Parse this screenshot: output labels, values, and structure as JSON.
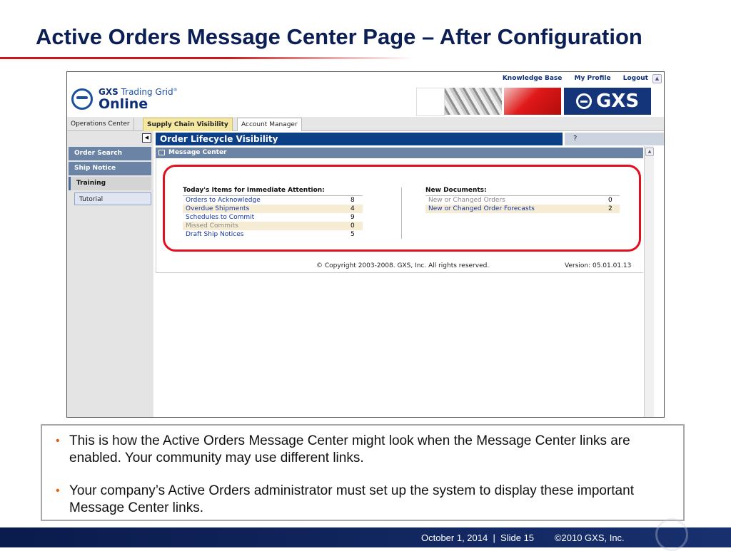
{
  "slide": {
    "title": "Active Orders Message Center Page – After Configuration",
    "bullets": [
      "This is how the Active Orders Message Center might look when the Message Center links are enabled. Your community may use different links.",
      "Your company’s Active Orders administrator must set up the system to display these important Message Center links."
    ],
    "footer": "October 1, 2014  |  Slide 15        ©2010 GXS, Inc."
  },
  "app": {
    "top_links": [
      "Knowledge Base",
      "My Profile",
      "Logout"
    ],
    "logo": {
      "line1_bold": "GXS",
      "line1_rest": " Trading Grid",
      "reg": "®",
      "line2": "Online"
    },
    "brand": "GXS",
    "tabs": [
      "Operations Center",
      "Supply Chain Visibility",
      "Account Manager"
    ],
    "active_tab": "Supply Chain Visibility",
    "sidebar": {
      "items": [
        "Order Search",
        "Ship Notice",
        "Training"
      ],
      "sub_items": [
        "Tutorial"
      ]
    },
    "section_title": "Order Lifecycle Visibility",
    "help_label": "?",
    "panel_title": "Message Center",
    "attention": {
      "title": "Today's Items for Immediate Attention:",
      "rows": [
        {
          "label": "Orders to Acknowledge",
          "count": "8"
        },
        {
          "label": "Overdue Shipments",
          "count": "4"
        },
        {
          "label": "Schedules to Commit",
          "count": "9"
        },
        {
          "label": "Missed Commits",
          "count": "0"
        },
        {
          "label": "Draft Ship Notices",
          "count": "5"
        }
      ]
    },
    "new_docs": {
      "title": "New Documents:",
      "rows": [
        {
          "label": "New or Changed Orders",
          "count": "0"
        },
        {
          "label": "New or Changed Order Forecasts",
          "count": "2"
        }
      ]
    },
    "copyright": "© Copyright 2003-2008. GXS, Inc. All rights reserved.",
    "version": "Version: 05.01.01.13"
  },
  "colors": {
    "accent_red": "#e01020",
    "nav_blue": "#0d3f87",
    "link_blue": "#1436a8"
  }
}
